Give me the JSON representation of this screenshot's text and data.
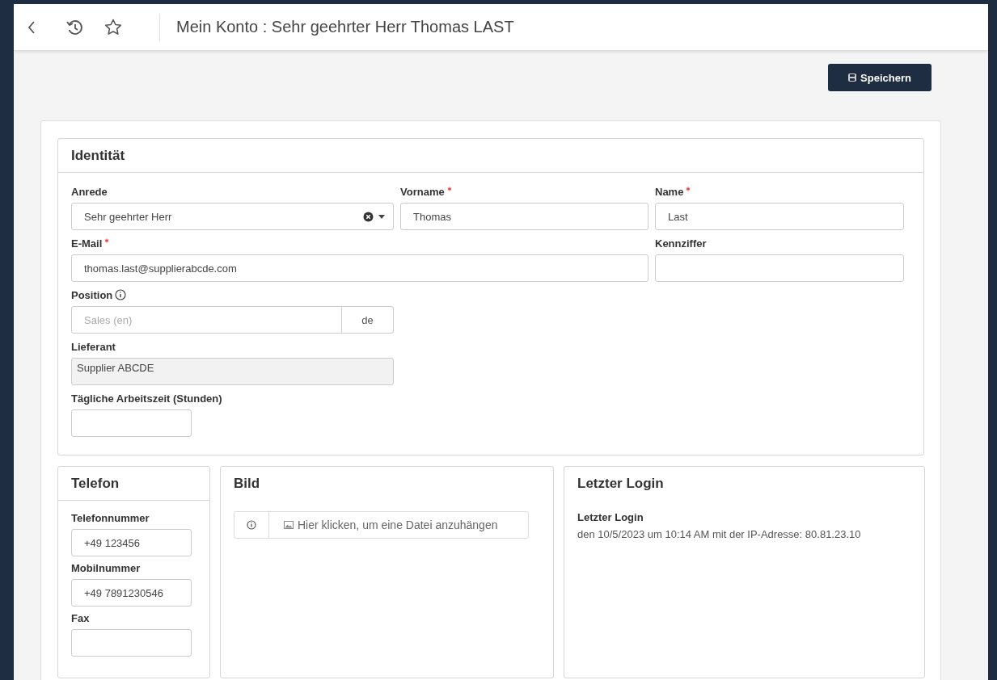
{
  "header": {
    "title": "Mein Konto : Sehr geehrter Herr Thomas LAST"
  },
  "save_button": {
    "label": "Speichern"
  },
  "identity": {
    "title": "Identität",
    "rows": [
      [
        {
          "kind": "select",
          "label": "Anrede",
          "required": false,
          "value": "Sehr geehrter Herr"
        },
        {
          "kind": "text",
          "label": "Vorname",
          "required": true,
          "value": "Thomas"
        },
        {
          "kind": "text",
          "label": "Name",
          "required": true,
          "value": "Last"
        }
      ],
      [
        {
          "kind": "email",
          "label": "E-Mail",
          "required": true,
          "value": "thomas.last@supplierabcde.com"
        },
        "",
        {
          "kind": "text",
          "label": "Kennziffer",
          "required": false
        }
      ],
      [
        {
          "kind": "translated",
          "label": "Position",
          "required": false,
          "info": true,
          "placeholder": "Sales (en)",
          "language": "de"
        }
      ],
      [
        {
          "kind": "readonly",
          "label": "Lieferant",
          "required": false,
          "value": "Supplier ABCDE"
        }
      ],
      [
        {
          "kind": "number",
          "label": "Tägliche Arbeitszeit (Stunden)",
          "required": false
        }
      ]
    ]
  },
  "phone": {
    "title": "Telefon",
    "fields": [
      {
        "label": "Telefonnummer",
        "value": "+49 123456"
      },
      {
        "label": "Mobilnummer",
        "value": "+49 7891230546"
      },
      {
        "label": "Fax"
      }
    ]
  },
  "picture": {
    "title": "Bild",
    "attach_label": "Hier klicken, um eine Datei anzuhängen"
  },
  "last_login": {
    "title": "Letzter Login",
    "label": "Letzter Login",
    "text": "den 10/5/2023 um 10:14 AM mit der IP-Adresse: 80.81.23.10"
  }
}
